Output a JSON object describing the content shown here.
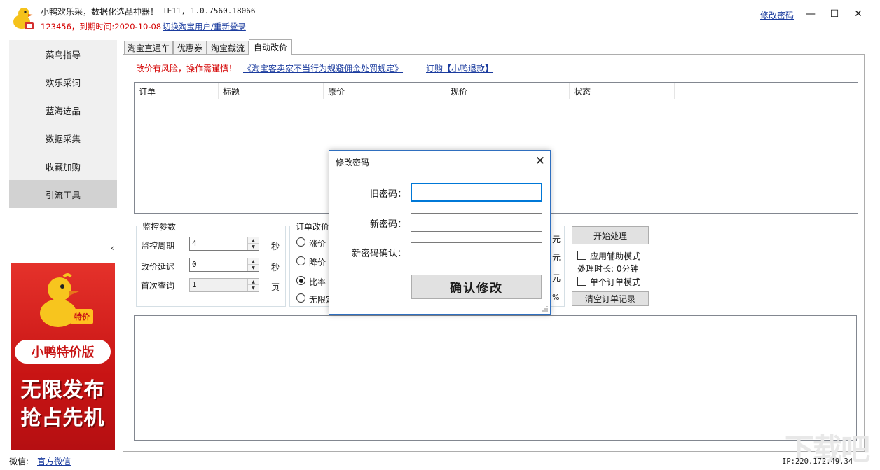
{
  "app": {
    "title": "小鸭欢乐采，数据化选品神器！",
    "version": "IE11, 1.0.7560.18066",
    "user_info": "123456，到期时间:2020-10-08",
    "switch_user": "切换淘宝用户/重新登录",
    "change_password": "修改密码"
  },
  "window": {
    "minimize": "—",
    "maximize": "☐",
    "close": "✕"
  },
  "sidebar": {
    "items": [
      {
        "label": "菜鸟指导"
      },
      {
        "label": "欢乐采词"
      },
      {
        "label": "蓝海选品"
      },
      {
        "label": "数据采集"
      },
      {
        "label": "收藏加购"
      },
      {
        "label": "引流工具",
        "active": true
      }
    ],
    "collapse": "‹"
  },
  "ad": {
    "tag": "特价",
    "band": "小鸭特价版",
    "line1": "无限发布",
    "line2": "抢占先机"
  },
  "footer": {
    "wechat_label": "微信:",
    "wechat_link": "官方微信",
    "ip": "IP:220.172.49.34",
    "watermark": "下载吧"
  },
  "tabs": [
    {
      "label": "淘宝直通车"
    },
    {
      "label": "优惠券"
    },
    {
      "label": "淘宝截流"
    },
    {
      "label": "自动改价",
      "active": true
    }
  ],
  "notice": {
    "risk": "改价有风险，操作需谨慎！",
    "rule_link": "《淘宝客卖家不当行为规避佣金处罚规定》",
    "buy_link": "订购【小鸭退款】"
  },
  "order_table": {
    "columns": [
      "订单",
      "标题",
      "原价",
      "现价",
      "状态"
    ]
  },
  "monitor": {
    "title": "监控参数",
    "rows": [
      {
        "label": "监控周期",
        "value": "4",
        "unit": "秒"
      },
      {
        "label": "改价延迟",
        "value": "0",
        "unit": "秒"
      },
      {
        "label": "首次查询",
        "value": "1",
        "unit": "页"
      }
    ]
  },
  "order_change": {
    "title": "订单改价",
    "options": [
      {
        "label": "涨价",
        "selected": false
      },
      {
        "label": "降价",
        "selected": false
      },
      {
        "label": "比率",
        "selected": true
      },
      {
        "label": "无限定",
        "selected": false
      }
    ],
    "units": [
      "元",
      "元",
      "元",
      "%"
    ]
  },
  "actions": {
    "start": "开始处理",
    "assist_mode": "应用辅助模式",
    "duration": "处理时长: 0分钟",
    "single_mode": "单个订单模式",
    "clear": "清空订单记录"
  },
  "dialog": {
    "title": "修改密码",
    "close": "✕",
    "old_label": "旧密码：",
    "new_label": "新密码：",
    "confirm_label": "新密码确认：",
    "old_value": "",
    "new_value": "",
    "confirm_value": "",
    "submit": "确认修改"
  },
  "colors": {
    "link": "#1a3b9e",
    "warn": "#d40000",
    "ad_red": "#c81414",
    "focus": "#0078d7"
  }
}
